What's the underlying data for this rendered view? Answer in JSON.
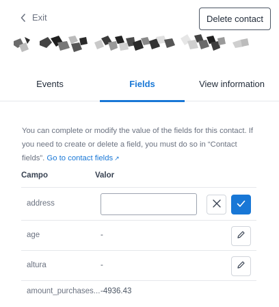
{
  "header": {
    "exit_label": "Exit",
    "delete_label": "Delete contact"
  },
  "tabs": [
    {
      "label": "Events",
      "active": false
    },
    {
      "label": "Fields",
      "active": true
    },
    {
      "label": "View information",
      "active": false
    }
  ],
  "description": {
    "text": "You can complete or modify the value of the fields for this contact. If you need to create or delete a field, you must do so in “Contact fields”.",
    "link_label": "Go to contact fields",
    "link_icon": "external-link-icon"
  },
  "table": {
    "col_field": "Campo",
    "col_value": "Valor",
    "rows": [
      {
        "name": "address",
        "value": "",
        "editing": true
      },
      {
        "name": "age",
        "value": "-",
        "editing": false
      },
      {
        "name": "altura",
        "value": "-",
        "editing": false
      },
      {
        "name": "amount_purchases...",
        "value": "-4936.43",
        "editing": false
      }
    ]
  },
  "colors": {
    "accent": "#1877d6",
    "muted_text": "#6b7280",
    "border": "#e5e7eb"
  }
}
